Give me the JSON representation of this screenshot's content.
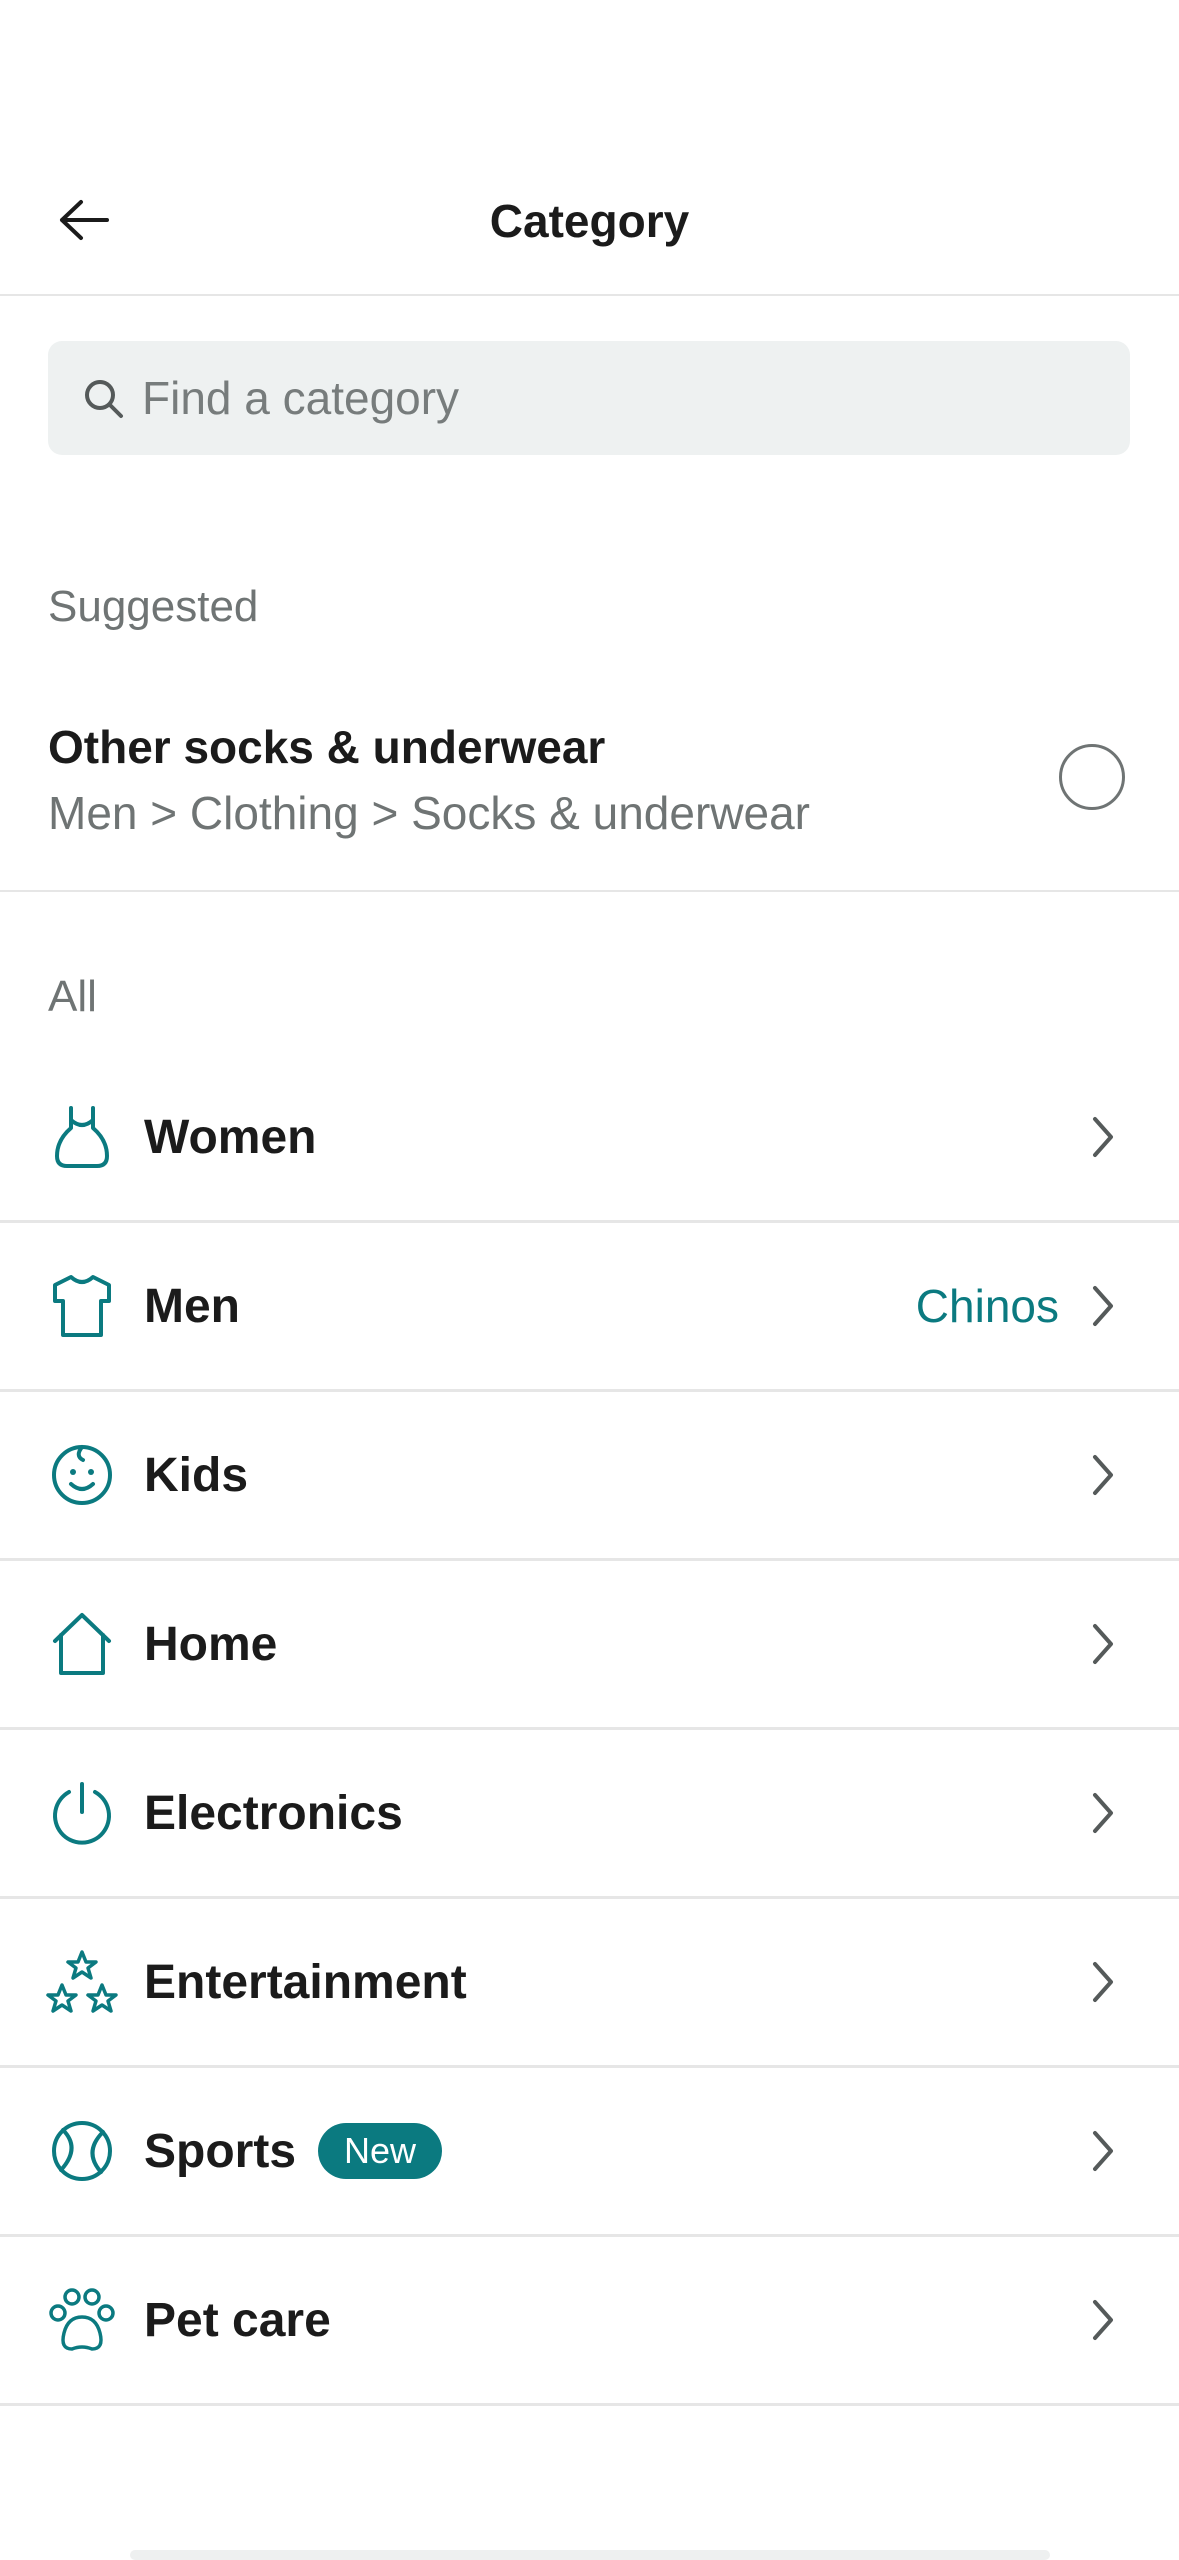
{
  "header": {
    "title": "Category",
    "back_icon": "arrow-left-icon"
  },
  "search": {
    "placeholder": "Find a category",
    "value": ""
  },
  "suggested": {
    "label": "Suggested",
    "item": {
      "title": "Other socks & underwear",
      "path": "Men > Clothing > Socks & underwear",
      "selected": false
    }
  },
  "all": {
    "label": "All",
    "items": [
      {
        "label": "Women",
        "icon": "dress-icon",
        "value": ""
      },
      {
        "label": "Men",
        "icon": "tshirt-icon",
        "value": "Chinos"
      },
      {
        "label": "Kids",
        "icon": "baby-face-icon",
        "value": ""
      },
      {
        "label": "Home",
        "icon": "house-icon",
        "value": ""
      },
      {
        "label": "Electronics",
        "icon": "power-icon",
        "value": ""
      },
      {
        "label": "Entertainment",
        "icon": "stars-icon",
        "value": ""
      },
      {
        "label": "Sports",
        "icon": "tennis-ball-icon",
        "value": "",
        "badge": "New"
      },
      {
        "label": "Pet care",
        "icon": "paw-icon",
        "value": ""
      }
    ]
  },
  "colors": {
    "accent": "#0b7a80",
    "text": "#1b1b1b",
    "muted": "#6f7474",
    "divider": "#e6e6e6",
    "search_bg": "#eef1f1"
  }
}
